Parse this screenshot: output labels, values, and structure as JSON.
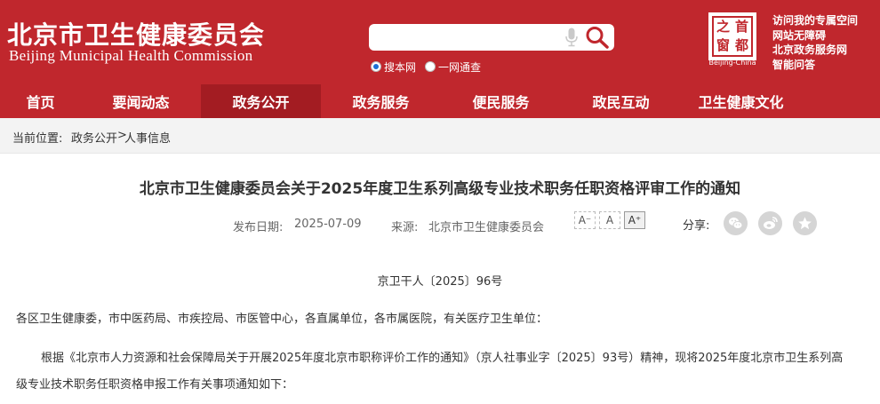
{
  "header": {
    "logo_cn": "北京市卫生健康委员会",
    "logo_en": "Beijing Municipal Health Commission",
    "search": {
      "placeholder": "",
      "value": ""
    },
    "radio_options": [
      {
        "label": "搜本网",
        "checked": true
      },
      {
        "label": "一网通查",
        "checked": false
      }
    ],
    "seal": {
      "chars": [
        "首",
        "之",
        "都",
        "窗"
      ],
      "caption": "Beijing-China"
    },
    "quick_links": [
      "访问我的专属空间",
      "网站无障碍",
      "北京政务服务网",
      "智能问答"
    ],
    "colors": {
      "brand_red": "#c0272d",
      "nav_active": "#a31c22"
    }
  },
  "nav": {
    "items": [
      "首页",
      "要闻动态",
      "政务公开",
      "政务服务",
      "便民服务",
      "政民互动",
      "卫生健康文化"
    ],
    "active_index": 2
  },
  "breadcrumb": {
    "label": "当前位置:",
    "items": [
      "政务公开",
      "人事信息"
    ],
    "separator": ">"
  },
  "article": {
    "title": "北京市卫生健康委员会关于2025年度卫生系列高级专业技术职务任职资格评审工作的通知",
    "date_label": "发布日期:",
    "date": "2025-07-09",
    "source_label": "来源:",
    "source": "北京市卫生健康委员会",
    "font_buttons": [
      "A⁻",
      "A",
      "A⁺"
    ],
    "share_label": "分享:",
    "share_icons": [
      "wechat-icon",
      "weibo-icon",
      "favorite-icon"
    ],
    "doc_number": "京卫干人〔2025〕96号",
    "recipients": "各区卫生健康委，市中医药局、市疾控局、市医管中心，各直属单位，各市属医院，有关医疗卫生单位：",
    "body_line1": "根据《北京市人力资源和社会保障局关于开展2025年度北京市职称评价工作的通知》（京人社事业字〔2025〕93号）精神，现将2025年度北京市卫生系列高",
    "body_line2": "级专业技术职务任职资格申报工作有关事项通知如下："
  }
}
